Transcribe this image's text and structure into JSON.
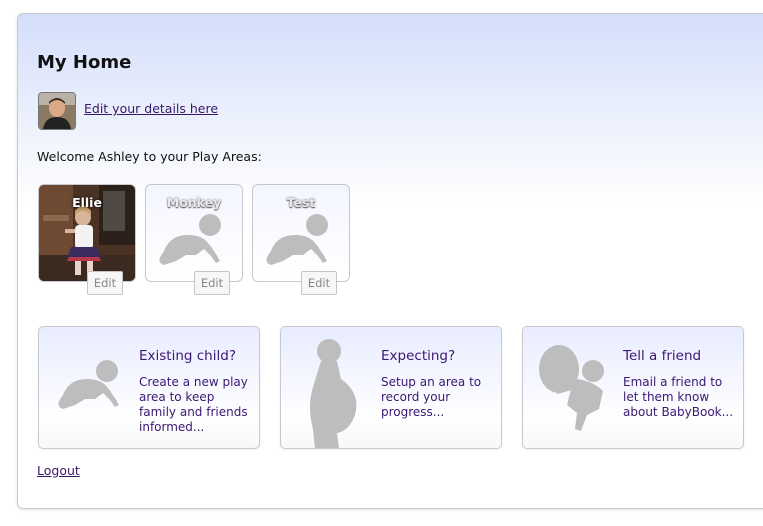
{
  "page": {
    "title": "My Home"
  },
  "profile": {
    "edit_link": "Edit your details here"
  },
  "welcome_text": "Welcome Ashley to your Play Areas:",
  "play_areas": [
    {
      "name": "Ellie",
      "edit": "Edit"
    },
    {
      "name": "Monkey",
      "edit": "Edit"
    },
    {
      "name": "Test",
      "edit": "Edit"
    }
  ],
  "actions": [
    {
      "title": "Existing child?",
      "desc": "Create a new play area to keep family and friends informed..."
    },
    {
      "title": "Expecting?",
      "desc": "Setup an area to record your progress..."
    },
    {
      "title": "Tell a friend",
      "desc": "Email a friend to let them know about BabyBook..."
    }
  ],
  "logout": "Logout",
  "icons": {
    "baby": "crawling-baby-icon",
    "pregnant": "pregnant-woman-icon",
    "friend": "baby-with-balloon-icon"
  },
  "colors": {
    "link": "#3a1868",
    "heading": "#3b1872",
    "silhouette": "#bdbdbd"
  }
}
